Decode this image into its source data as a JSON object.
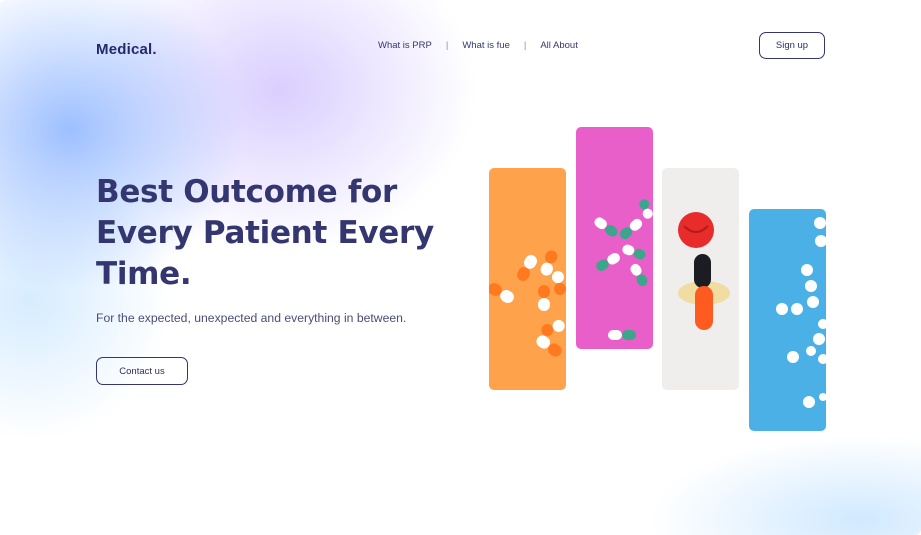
{
  "header": {
    "brand": "Medical.",
    "nav": [
      {
        "label": "What is PRP"
      },
      {
        "label": "What is fue"
      },
      {
        "label": "All About"
      }
    ],
    "nav_separator": "|",
    "signup_label": "Sign up"
  },
  "hero": {
    "title_lines": [
      "Best Outcome for",
      "Every Patient Every",
      "Time."
    ],
    "subtitle": "For the expected, unexpected and everything in between.",
    "cta_label": "Contact us"
  },
  "panels": [
    {
      "name": "orange-pills-panel",
      "color": "#ffa24c",
      "content": "orange-white-capsules"
    },
    {
      "name": "pink-pills-panel",
      "color": "#e95fc9",
      "content": "green-white-capsules"
    },
    {
      "name": "grey-pills-panel",
      "color": "#f0eeed",
      "content": "red-and-orange-capsules"
    },
    {
      "name": "blue-pills-panel",
      "color": "#4ab0e6",
      "content": "white-round-tablets"
    }
  ],
  "colors": {
    "primary_text": "#34366f",
    "brand": "#25296b",
    "body_text": "#4a4d77"
  }
}
